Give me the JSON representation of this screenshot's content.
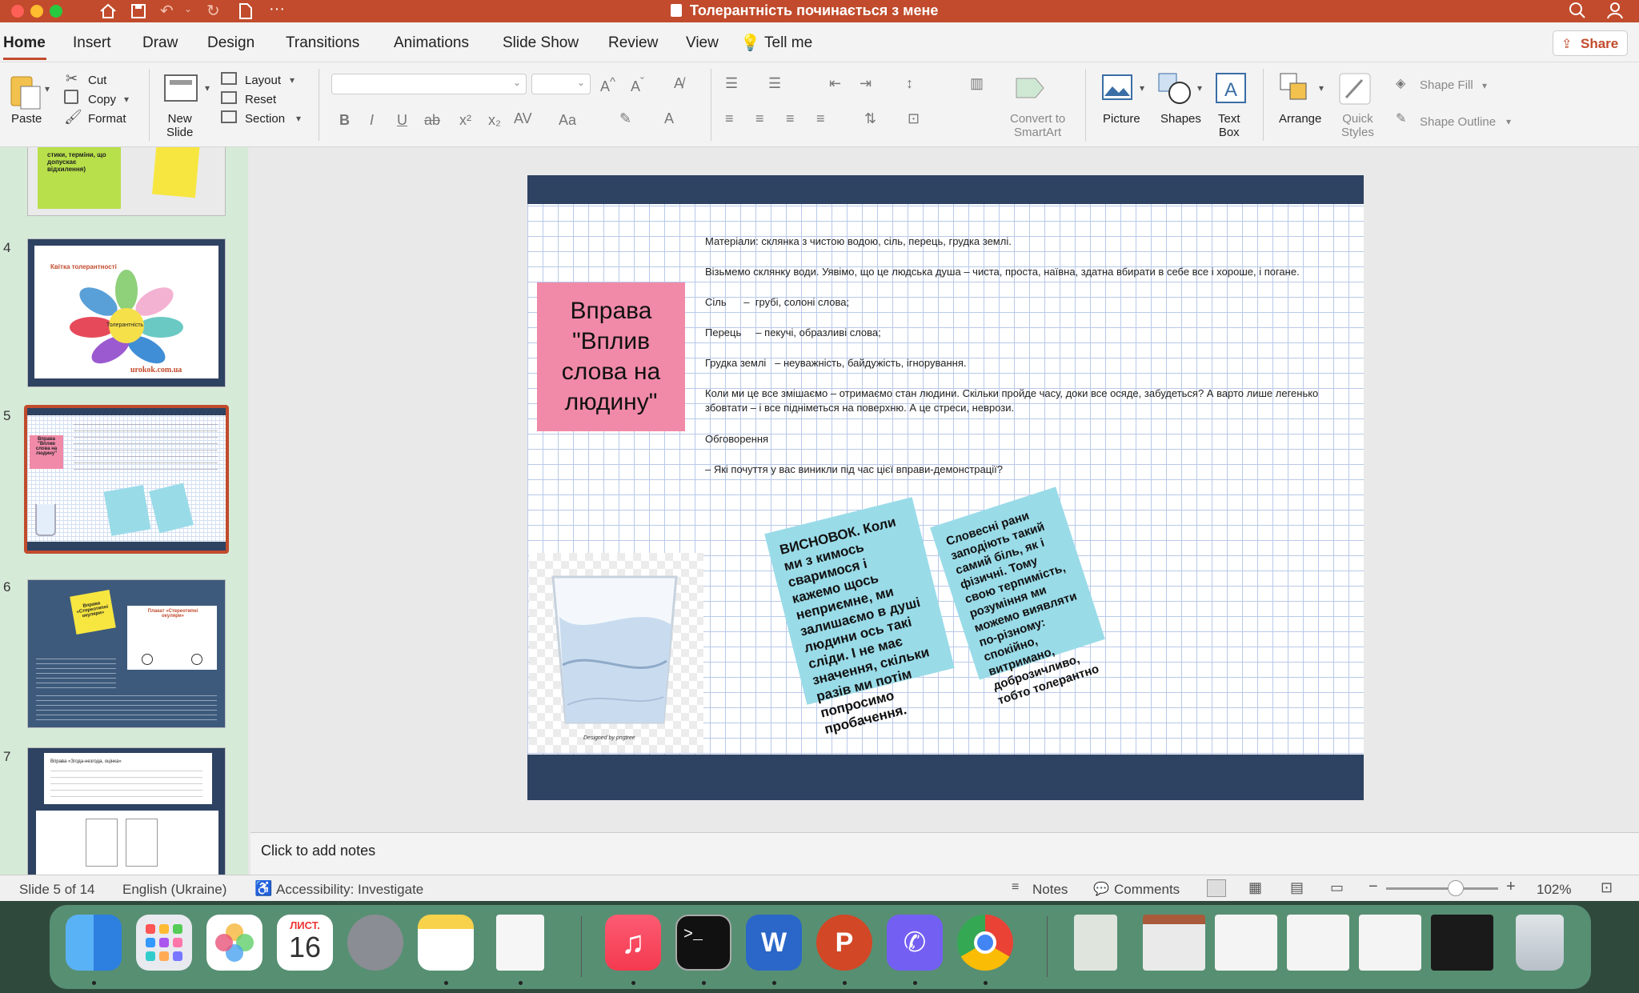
{
  "window": {
    "title": "Толерантність починається з мене"
  },
  "tabs": [
    "Home",
    "Insert",
    "Draw",
    "Design",
    "Transitions",
    "Animations",
    "Slide Show",
    "Review",
    "View"
  ],
  "tell_me": "Tell me",
  "share": "Share",
  "ribbon": {
    "paste": "Paste",
    "cut": "Cut",
    "copy": "Copy",
    "format": "Format",
    "new_slide": "New\nSlide",
    "layout": "Layout",
    "reset": "Reset",
    "section": "Section",
    "convert": "Convert to\nSmartArt",
    "picture": "Picture",
    "shapes": "Shapes",
    "text_box": "Text\nBox",
    "arrange": "Arrange",
    "quick_styles": "Quick\nStyles",
    "shape_fill": "Shape Fill",
    "shape_outline": "Shape Outline"
  },
  "thumbnails": {
    "nums": [
      "4",
      "5",
      "6",
      "7"
    ],
    "t3_text": "стики, терміни, що допускає відхилення)",
    "t4_title": "Квітка толерантності",
    "t4_center": "Толерантність",
    "t4_site": "urokok.com.ua",
    "t5_title": "Вправа \"Вплив слова на людину\"",
    "t6_title": "Вправа «Стереотипні окуляри»",
    "t6_card": "Плакат «Стереотипні окуляри»",
    "t7_line1": "Вправа «Згода-незгода, оцінка»"
  },
  "slide": {
    "title_box": "Вправа \"Вплив слова на людину\"",
    "lines": [
      "Матеріали: склянка з чистою водою, сіль, перець, грудка землі.",
      "Візьмемо склянку води. Уявімо, що це людська душа – чиста, проста, наївна, здатна вбирати в себе все і хороше, і погане.",
      "Сіль      –  грубі, солоні слова;",
      "Перець     – пекучі, образливі слова;",
      "Грудка землі   – неуважність, байдужість, ігнорування.",
      "Коли ми це все змішаємо – отримаємо стан людини. Скільки пройде часу, доки все осяде, забудеться? А варто лише легенько збовтати – і все підніметься на поверхню. А це стреси, неврози.",
      "Обговорення",
      "–  Які почуття у вас виникли під час цієї вправи-демонстрації?"
    ],
    "note1": "ВИСНОВОК. Коли ми з кимось сваримося і кажемо щось неприємне, ми залишаємо в душі людини ось такі сліди. І не має значення, скільки разів ми потім попросимо пробачення.",
    "note2": "Словесні рани заподіють такий самий біль, як і фізичні. Тому свою терпимість, розуміння ми можемо виявляти по-різному: спокійно, витримано, доброзичливо, тобто толерантно",
    "glass_caption": "Designed by pngtree"
  },
  "notes_placeholder": "Click to add notes",
  "status": {
    "slide": "Slide 5 of 14",
    "language": "English (Ukraine)",
    "accessibility": "Accessibility: Investigate",
    "notes": "Notes",
    "comments": "Comments",
    "zoom": "102%",
    "zoom_level": 0.62
  },
  "dock": {
    "calendar_month": "ЛИСТ.",
    "calendar_day": "16"
  },
  "colors": {
    "accent": "#c14b2c",
    "slide_band": "#2e4262",
    "title_box": "#f08aa8",
    "note": "#9adbe8"
  }
}
